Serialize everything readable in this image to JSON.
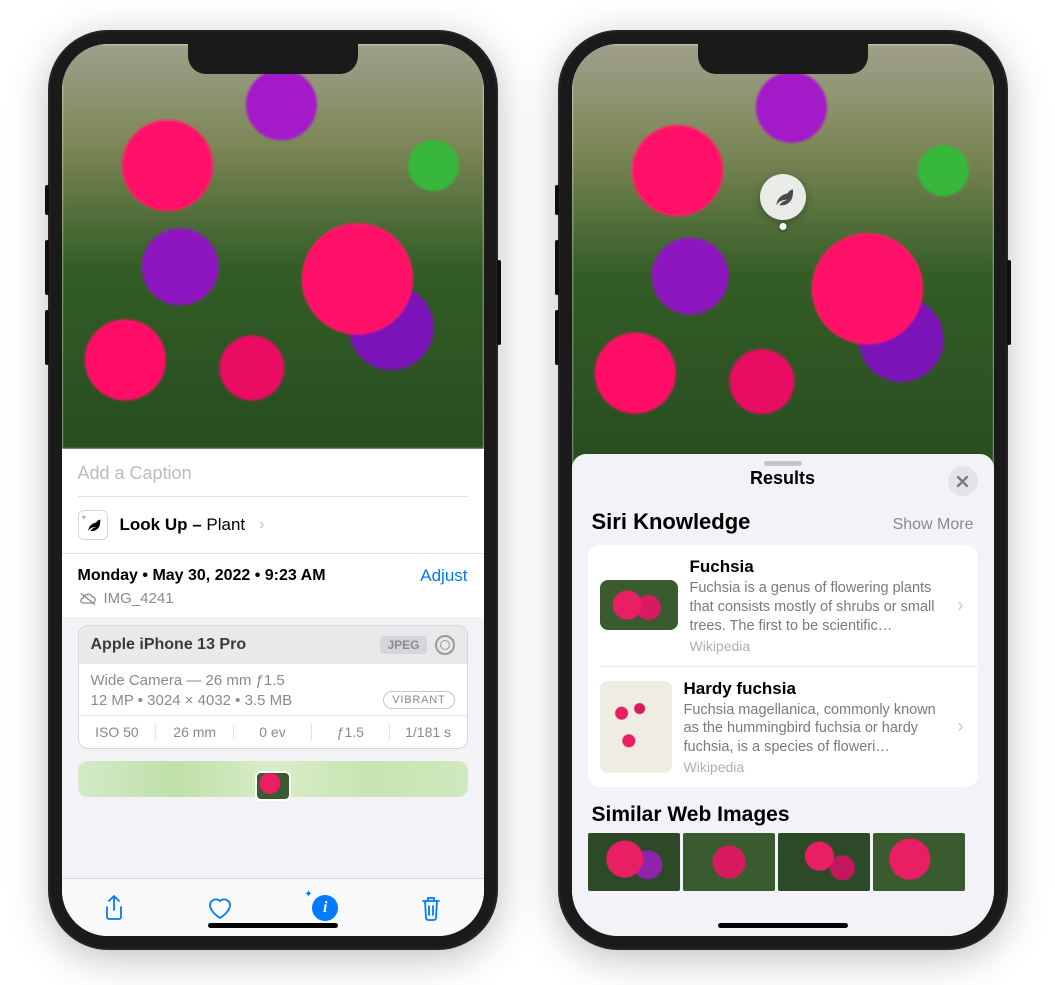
{
  "left": {
    "caption_placeholder": "Add a Caption",
    "lookup_label_prefix": "Look Up – ",
    "lookup_category": "Plant",
    "date_line": "Monday • May 30, 2022 • 9:23 AM",
    "adjust_label": "Adjust",
    "filename": "IMG_4241",
    "exif": {
      "device": "Apple iPhone 13 Pro",
      "format_badge": "JPEG",
      "lens": "Wide Camera — 26 mm ƒ1.5",
      "stats": "12 MP  •  3024 × 4032  •  3.5 MB",
      "style_badge": "VIBRANT",
      "iso": "ISO 50",
      "focal": "26 mm",
      "ev": "0 ev",
      "aperture": "ƒ1.5",
      "shutter": "1/181 s"
    }
  },
  "right": {
    "sheet_title": "Results",
    "siri_knowledge_title": "Siri Knowledge",
    "show_more_label": "Show More",
    "results": [
      {
        "title": "Fuchsia",
        "desc": "Fuchsia is a genus of flowering plants that consists mostly of shrubs or small trees. The first to be scientific…",
        "source": "Wikipedia"
      },
      {
        "title": "Hardy fuchsia",
        "desc": "Fuchsia magellanica, commonly known as the hummingbird fuchsia or hardy fuchsia, is a species of floweri…",
        "source": "Wikipedia"
      }
    ],
    "similar_title": "Similar Web Images"
  }
}
